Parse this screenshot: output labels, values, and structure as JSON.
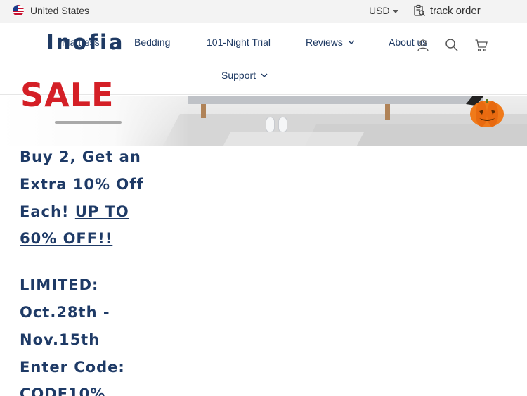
{
  "topbar": {
    "region_label": "United States",
    "region_icon": "us-flag-icon",
    "currency_label": "USD",
    "track_label": "track order",
    "track_icon": "track-order-icon"
  },
  "header": {
    "logo_text": "Inofia",
    "nav": [
      {
        "label": "Mattress",
        "has_dropdown": true
      },
      {
        "label": "Bedding",
        "has_dropdown": false
      },
      {
        "label": "101-Night Trial",
        "has_dropdown": false
      },
      {
        "label": "Reviews",
        "has_dropdown": true
      },
      {
        "label": "About us",
        "has_dropdown": false
      },
      {
        "label": "Support",
        "has_dropdown": true
      }
    ],
    "icons": [
      "account-icon",
      "search-icon",
      "cart-icon"
    ]
  },
  "banner": {
    "sale_text": "SALE"
  },
  "promo": {
    "line1": "Buy 2, Get an",
    "line2": "Extra 10% Off",
    "line3_prefix": "Each! ",
    "line3_link": "UP TO",
    "line4_link": "60% OFF!!",
    "line5": "LIMITED:",
    "line6": "Oct.28th -",
    "line7": "Nov.15th",
    "line8": "Enter Code:",
    "line9": "CODE10%"
  },
  "colors": {
    "brand_navy": "#1f3a63",
    "sale_red": "#d41f26",
    "topbar_bg": "#f3f3f3"
  }
}
